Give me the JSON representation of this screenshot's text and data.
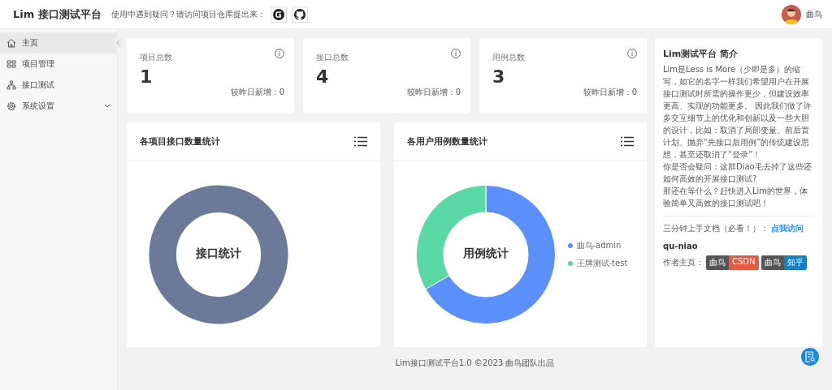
{
  "header": {
    "title": "Lim 接口测试平台",
    "notice": "使用中遇到疑问？请访问项目仓库提出来：",
    "user": "曲鸟"
  },
  "sidebar": {
    "items": [
      {
        "label": "主页",
        "selected": true,
        "expandable": false
      },
      {
        "label": "项目管理",
        "selected": false,
        "expandable": false
      },
      {
        "label": "接口测试",
        "selected": false,
        "expandable": false
      },
      {
        "label": "系统设置",
        "selected": false,
        "expandable": true
      }
    ]
  },
  "stats": [
    {
      "label": "项目总数",
      "value": "1",
      "delta": "较昨日新增：0"
    },
    {
      "label": "接口总数",
      "value": "4",
      "delta": "较昨日新增：0"
    },
    {
      "label": "用例总数",
      "value": "3",
      "delta": "较昨日新增：0"
    }
  ],
  "charts": [
    {
      "title": "各项目接口数量统计",
      "center": "接口统计"
    },
    {
      "title": "各用户用例数量统计",
      "center": "用例统计",
      "chart_data": {
        "type": "donut",
        "categories": [
          "曲鸟-admin",
          "王牌测试-test"
        ],
        "values": [
          66.7,
          33.3
        ],
        "colors": [
          "#5b8ff9",
          "#5ad8a6"
        ]
      }
    }
  ],
  "intro": {
    "title": "Lim测试平台 简介",
    "paragraphs": [
      "Lim是Less is More（少即是多）的缩写，如它的名字一样我们希望用户在开展接口测试时所需的操作更少，但建设效率更高、实现的功能更多。 因此我们做了许多交互细节上的优化和创新以及一些大胆的设计，比如：取消了局部变量、前后置计划、抛弃“先接口后用例”的传统建设思想，甚至还取消了“登录”！",
      "你是否会疑问：这群Diao毛去掉了这些还如何高效的开展接口测试?",
      "那还在等什么？赶快进入Lim的世界，体验简单又高效的接口测试吧！"
    ],
    "doc_label": "三分钟上手文档（必看！）：",
    "doc_link": "点我访问",
    "author_id": "qu-niao",
    "home_label": "作者主页：",
    "badges": [
      {
        "name": "曲鸟",
        "site": "CSDN",
        "color": "#e05d44"
      },
      {
        "name": "曲鸟",
        "site": "知乎",
        "color": "#1a7fc1"
      }
    ]
  },
  "footer": "Lim接口测试平台1.0 ©2023 曲鸟团队出品"
}
